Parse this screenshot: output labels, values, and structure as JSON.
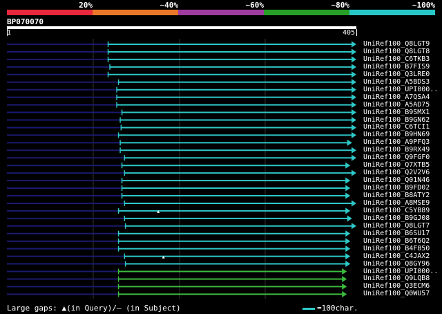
{
  "identity_scale": [
    {
      "label": "20%",
      "color": "#e8283c"
    },
    {
      "label": "~40%",
      "color": "#e87828"
    },
    {
      "label": "~60%",
      "color": "#a03ca0"
    },
    {
      "label": "~80%",
      "color": "#28a028"
    },
    {
      "label": "~100%",
      "color": "#28c8c8"
    }
  ],
  "query": {
    "id": "BP070070",
    "start_label": "1",
    "end_label": "405",
    "length": 405
  },
  "colors": {
    "hit_high": "#2ec8c8",
    "hit_80": "#3cbc3c",
    "unaligned": "#1a1a70",
    "grid": "#333333",
    "gap_mark": "#ffffff"
  },
  "hits": [
    {
      "label": "UniRef100_Q8LGT9",
      "start": 118,
      "end": 405,
      "arrow": "right",
      "tier": "high"
    },
    {
      "label": "UniRef100_Q8LGT8",
      "start": 118,
      "end": 405,
      "arrow": "right",
      "tier": "high"
    },
    {
      "label": "UniRef100_C6TKB3",
      "start": 118,
      "end": 405,
      "arrow": "right",
      "tier": "high"
    },
    {
      "label": "UniRef100_B7FIS9",
      "start": 120,
      "end": 405,
      "arrow": "right",
      "tier": "high"
    },
    {
      "label": "UniRef100_Q3LRE0",
      "start": 118,
      "end": 405,
      "arrow": "right",
      "tier": "high"
    },
    {
      "label": "UniRef100_A5BDS3",
      "start": 130,
      "end": 405,
      "arrow": "right",
      "tier": "high"
    },
    {
      "label": "UniRef100_UPI000..",
      "start": 128,
      "end": 405,
      "arrow": "right",
      "tier": "high"
    },
    {
      "label": "UniRef100_A7QSA4",
      "start": 128,
      "end": 405,
      "arrow": "right",
      "tier": "high"
    },
    {
      "label": "UniRef100_A5AD75",
      "start": 128,
      "end": 405,
      "arrow": "right",
      "tier": "high"
    },
    {
      "label": "UniRef100_B9SMX1",
      "start": 134,
      "end": 405,
      "arrow": "right",
      "tier": "high"
    },
    {
      "label": "UniRef100_B9GN62",
      "start": 132,
      "end": 405,
      "arrow": "right",
      "tier": "high"
    },
    {
      "label": "UniRef100_C6TCI1",
      "start": 133,
      "end": 405,
      "arrow": "right",
      "tier": "high"
    },
    {
      "label": "UniRef100_B9HN69",
      "start": 130,
      "end": 405,
      "arrow": "right",
      "tier": "high"
    },
    {
      "label": "UniRef100_A9PFQ3",
      "start": 132,
      "end": 400,
      "arrow": "right",
      "tier": "high"
    },
    {
      "label": "UniRef100_B9RX49",
      "start": 132,
      "end": 405,
      "arrow": "right",
      "tier": "high"
    },
    {
      "label": "UniRef100_Q9FGF0",
      "start": 137,
      "end": 405,
      "arrow": "right",
      "tier": "high"
    },
    {
      "label": "UniRef100_Q7XTB5",
      "start": 134,
      "end": 398,
      "arrow": "right",
      "tier": "high"
    },
    {
      "label": "UniRef100_Q2V2V6",
      "start": 137,
      "end": 405,
      "arrow": "right",
      "tier": "high"
    },
    {
      "label": "UniRef100_Q01N46",
      "start": 134,
      "end": 398,
      "arrow": "right",
      "tier": "high"
    },
    {
      "label": "UniRef100_B9FD02",
      "start": 134,
      "end": 398,
      "arrow": "right",
      "tier": "high"
    },
    {
      "label": "UniRef100_B8ATY2",
      "start": 134,
      "end": 398,
      "arrow": "right",
      "tier": "high"
    },
    {
      "label": "UniRef100_A8MSE9",
      "start": 137,
      "end": 405,
      "arrow": "right",
      "tier": "high"
    },
    {
      "label": "UniRef100_C5YB89",
      "start": 130,
      "end": 398,
      "arrow": "right",
      "tier": "high",
      "query_gap_at": 176
    },
    {
      "label": "UniRef100_B9GJ08",
      "start": 137,
      "end": 400,
      "arrow": "right",
      "tier": "high"
    },
    {
      "label": "UniRef100_Q8LGT7",
      "start": 138,
      "end": 405,
      "arrow": "right",
      "tier": "high"
    },
    {
      "label": "UniRef100_B6SU17",
      "start": 130,
      "end": 398,
      "arrow": "right",
      "tier": "high"
    },
    {
      "label": "UniRef100_B6T6Q2",
      "start": 130,
      "end": 398,
      "arrow": "right",
      "tier": "high"
    },
    {
      "label": "UniRef100_B4F850",
      "start": 130,
      "end": 398,
      "arrow": "right",
      "tier": "high"
    },
    {
      "label": "UniRef100_C4JAX2",
      "start": 137,
      "end": 398,
      "arrow": "right",
      "tier": "high",
      "query_gap_at": 182
    },
    {
      "label": "UniRef100_Q8GY96",
      "start": 138,
      "end": 398,
      "arrow": "right",
      "tier": "high"
    },
    {
      "label": "UniRef100_UPI000..",
      "start": 130,
      "end": 394,
      "arrow": "right",
      "tier": "80"
    },
    {
      "label": "UniRef100_Q9LQB8",
      "start": 130,
      "end": 394,
      "arrow": "right",
      "tier": "80"
    },
    {
      "label": "UniRef100_Q3ECM6",
      "start": 130,
      "end": 394,
      "arrow": "right",
      "tier": "80"
    },
    {
      "label": "UniRef100_Q0WU57",
      "start": 130,
      "end": 394,
      "arrow": "right",
      "tier": "80"
    }
  ],
  "legend": {
    "gaps_text": "Large gaps: ▲(in Query)/— (in Subject)",
    "scale_text": "=100char."
  }
}
